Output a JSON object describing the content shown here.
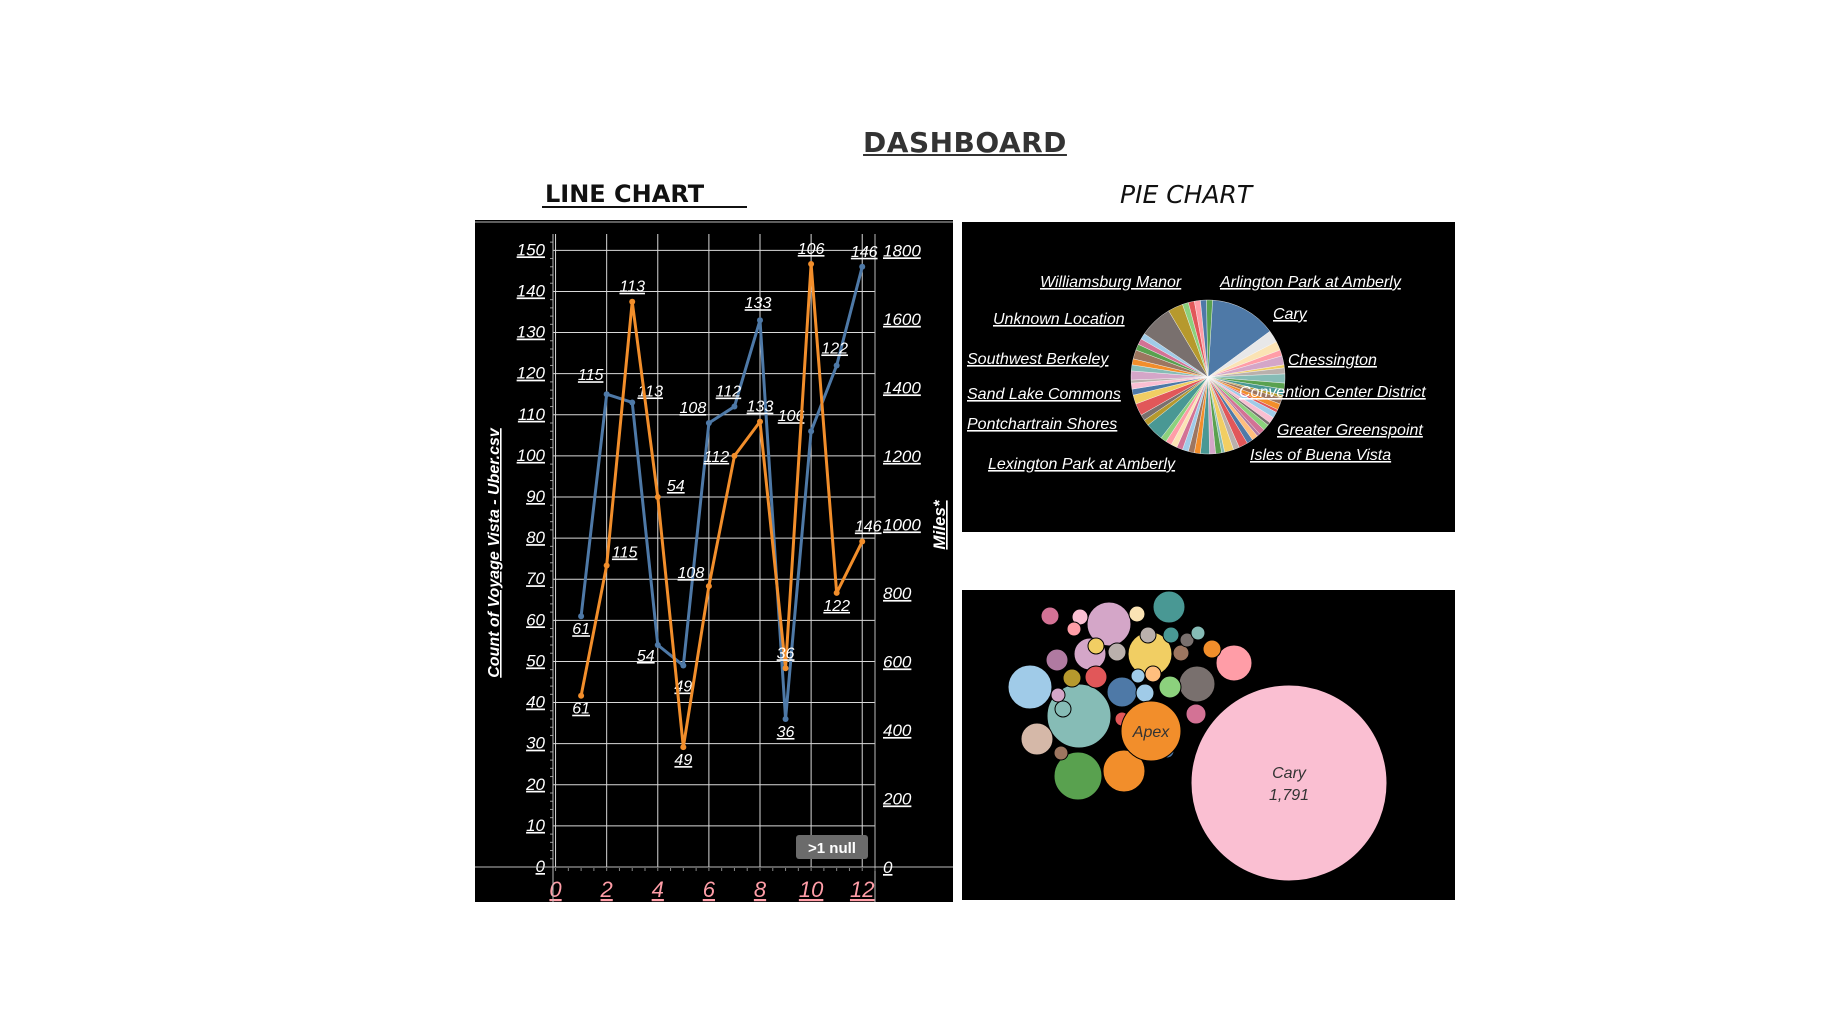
{
  "dashboard": {
    "title": "DASHBOARD"
  },
  "colors": {
    "blue": "#4e79a7",
    "orange": "#f28e2b",
    "panel": "#000000",
    "tick_x": "#ff9da7"
  },
  "chart_data": [
    {
      "type": "line",
      "title": "LINE CHART",
      "ylabel": "Count of Voyage Vista - Uber.csv",
      "y2label": "Miles*",
      "x_ticks": [
        "0",
        "2",
        "4",
        "6",
        "8",
        "10",
        "12"
      ],
      "y_ticks": [
        "0",
        "10",
        "20",
        "30",
        "40",
        "50",
        "60",
        "70",
        "80",
        "90",
        "100",
        "110",
        "120",
        "130",
        "140",
        "150"
      ],
      "y2_ticks": [
        "0",
        "200",
        "400",
        "600",
        "800",
        "1000",
        "1200",
        "1400",
        "1600",
        "1800"
      ],
      "xlim": [
        -0.1,
        12.5
      ],
      "ylim": [
        0,
        153
      ],
      "y2lim": [
        0,
        1836
      ],
      "badge": ">1 null",
      "series": [
        {
          "axis": "left",
          "color": "blue",
          "x": [
            1,
            2,
            3,
            4,
            5,
            6,
            7,
            8,
            9,
            10,
            11,
            12
          ],
          "y": [
            61,
            115,
            113,
            54,
            49,
            108,
            112,
            133,
            36,
            106,
            122,
            146
          ],
          "labels": [
            "61",
            "115",
            "113",
            "54",
            "49",
            "108",
            "112",
            "133",
            "36",
            "106",
            "122",
            "146"
          ]
        },
        {
          "axis": "right",
          "color": "orange",
          "x": [
            1,
            2,
            3,
            4,
            5,
            6,
            7,
            8,
            9,
            10,
            11,
            12
          ],
          "y": [
            500,
            880,
            1650,
            1080,
            350,
            820,
            1200,
            1300,
            580,
            1760,
            800,
            950
          ],
          "labels": [
            "61",
            "115",
            "113",
            "54",
            "49",
            "108",
            "112",
            "133",
            "36",
            "106",
            "122",
            "146"
          ]
        }
      ]
    },
    {
      "type": "pie",
      "title": "PIE CHART",
      "slice_values": [
        22,
        4,
        3,
        2,
        3,
        1,
        2,
        3,
        2,
        2,
        1,
        2,
        2,
        1,
        2,
        2,
        1,
        2,
        2,
        1,
        2,
        2,
        3,
        2,
        3,
        1,
        2,
        2,
        3,
        2,
        2,
        2,
        2,
        2,
        2,
        2,
        6,
        2,
        2,
        4,
        3,
        2,
        2,
        1,
        3,
        2,
        2,
        3,
        2,
        2,
        2,
        11,
        5,
        2,
        2,
        2,
        2,
        2
      ],
      "slice_colors": [
        "#4e79a7",
        "#e8e8e8",
        "#fbe3b4",
        "#ff9da7",
        "#d4a6c8",
        "#f1ce63",
        "#bab0ac",
        "#86bcb6",
        "#59a14f",
        "#499894",
        "#b6992d",
        "#9d7660",
        "#f28e2b",
        "#e15759",
        "#a0cbe8",
        "#fabfd2",
        "#79706e",
        "#8cd17d",
        "#d37295",
        "#b07aa1",
        "#ffbe7d",
        "#4e79a7",
        "#e15759",
        "#bab0ac",
        "#f1ce63",
        "#86bcb6",
        "#59a14f",
        "#d4a6c8",
        "#499894",
        "#f28e2b",
        "#9d7660",
        "#a0cbe8",
        "#d37295",
        "#fbe3b4",
        "#ff9da7",
        "#8cd17d",
        "#499894",
        "#b6992d",
        "#79706e",
        "#e15759",
        "#f1ce63",
        "#4e79a7",
        "#fabfd2",
        "#bab0ac",
        "#d4a6c8",
        "#86bcb6",
        "#f28e2b",
        "#9d7660",
        "#59a14f",
        "#d37295",
        "#a0cbe8",
        "#79706e",
        "#b6992d",
        "#8cd17d",
        "#e15759",
        "#ff9da7",
        "#4e79a7",
        "#59a14f"
      ],
      "labels": [
        "Williamsburg Manor",
        "Arlington Park at Amberly",
        "Cary",
        "Unknown Location",
        "Chessington",
        "Southwest Berkeley",
        "Convention Center District",
        "Sand Lake Commons",
        "Pontchartrain Shores",
        "Greater Greenspoint",
        "Isles of Buena Vista",
        "Lexington Park at Amberly"
      ]
    },
    {
      "type": "bubble",
      "bubbles": [
        {
          "label": "Cary",
          "value": "1,791",
          "color": "#fabfd2",
          "r": 98
        },
        {
          "label": "Apex",
          "value": "",
          "color": "#f28e2b",
          "r": 30
        }
      ],
      "small_colors": [
        "#86bcb6",
        "#59a14f",
        "#f28e2b",
        "#a0cbe8",
        "#d4a6c8",
        "#f1ce63",
        "#499894",
        "#d4a6c8",
        "#79706e",
        "#ff9da7",
        "#d5b8a8",
        "#4e79a7",
        "#e15759",
        "#8cd17d",
        "#b07aa1",
        "#bab0ac",
        "#f28e2b",
        "#59a14f",
        "#e15759",
        "#a0cbe8",
        "#d37295",
        "#9d7660",
        "#fbe3b4",
        "#499894",
        "#fabfd2",
        "#b6992d",
        "#f1ce63",
        "#86bcb6",
        "#e15759",
        "#4e79a7",
        "#bab0ac",
        "#d37295",
        "#ffbe7d",
        "#9d7660",
        "#a0cbe8",
        "#59a14f",
        "#79706e",
        "#ff9da7",
        "#86bcb6",
        "#d4a6c8"
      ]
    }
  ]
}
